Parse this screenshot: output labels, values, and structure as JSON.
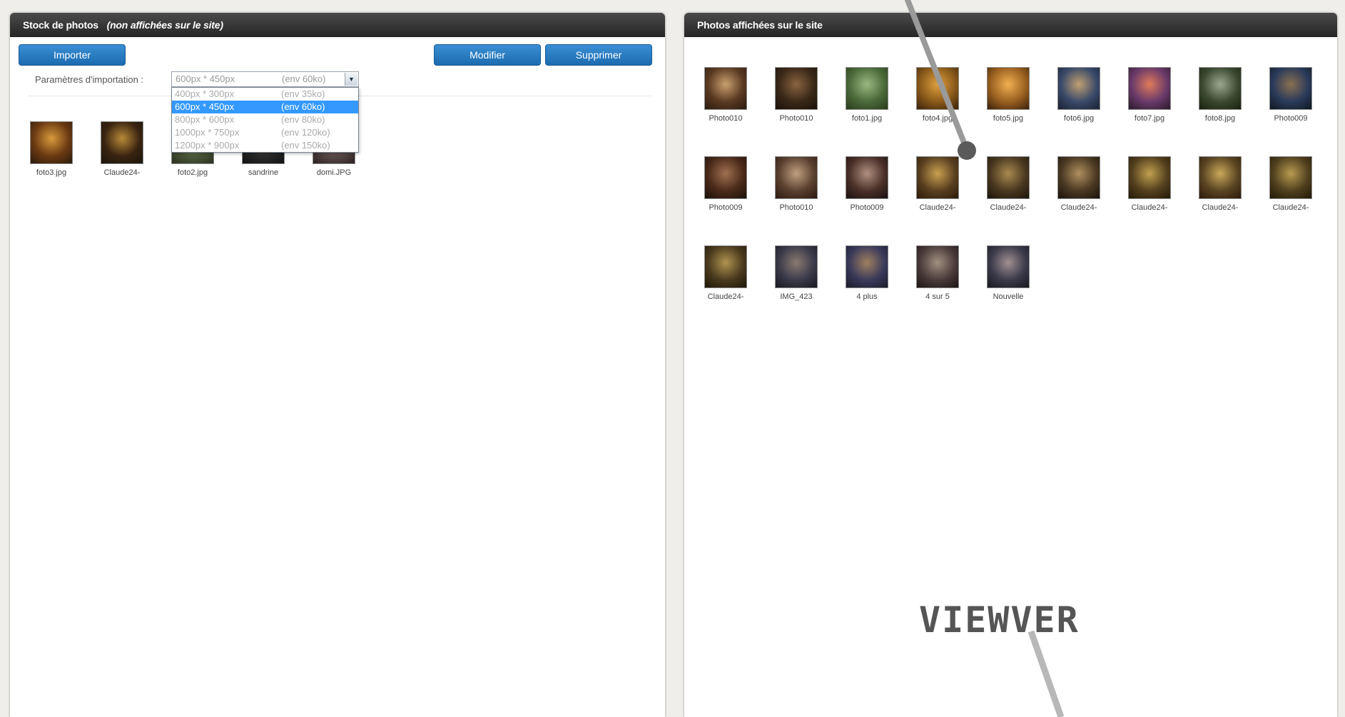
{
  "left_panel": {
    "title": "Stock de photos",
    "note": "(non affichées sur le site)",
    "buttons": {
      "import": "Importer",
      "modify": "Modifier",
      "delete": "Supprimer"
    },
    "import_params": {
      "label": "Paramètres d'importation :",
      "selected_size": "600px * 450px",
      "selected_weight": "(env 60ko)",
      "options": [
        {
          "size": "400px * 300px",
          "weight": "(env 35ko)"
        },
        {
          "size": "600px * 450px",
          "weight": "(env 60ko)"
        },
        {
          "size": "800px * 600px",
          "weight": "(env 80ko)"
        },
        {
          "size": "1000px * 750px",
          "weight": "(env 120ko)"
        },
        {
          "size": "1200px * 900px",
          "weight": "(env 150ko)"
        }
      ],
      "selected_index": 1
    },
    "photos": [
      {
        "caption": "foto3.jpg",
        "colors": [
          "#6b3a12",
          "#d89a3c",
          "#2b1a0c"
        ]
      },
      {
        "caption": "Claude24-",
        "colors": [
          "#3a2410",
          "#b88a3a",
          "#1b140c"
        ]
      },
      {
        "caption": "foto2.jpg",
        "colors": [
          "#4c5a3a",
          "#9fae80",
          "#2a3020"
        ]
      },
      {
        "caption": "sandrine",
        "colors": [
          "#2a2a2a",
          "#6a5040",
          "#111111"
        ]
      },
      {
        "caption": "domi.JPG",
        "colors": [
          "#5a4a4a",
          "#a08070",
          "#2a2020"
        ]
      }
    ]
  },
  "right_panel": {
    "title": "Photos affichées sur le site",
    "photos": [
      {
        "caption": "Photo010",
        "colors": [
          "#5a3a22",
          "#c9a070",
          "#2a1a10"
        ]
      },
      {
        "caption": "Photo010",
        "colors": [
          "#3a2818",
          "#8a6440",
          "#1a120a"
        ]
      },
      {
        "caption": "foto1.jpg",
        "colors": [
          "#4a6a3a",
          "#9ab880",
          "#2a3a1a"
        ]
      },
      {
        "caption": "foto4.jpg",
        "colors": [
          "#8a5a1a",
          "#e0a040",
          "#3a200a"
        ]
      },
      {
        "caption": "foto5.jpg",
        "colors": [
          "#9a6020",
          "#f0b050",
          "#3a200a"
        ]
      },
      {
        "caption": "foto6.jpg",
        "colors": [
          "#3a4a6a",
          "#c0a070",
          "#1a2030"
        ]
      },
      {
        "caption": "foto7.jpg",
        "colors": [
          "#6a3a6a",
          "#e07a5a",
          "#2a1a2a"
        ]
      },
      {
        "caption": "foto8.jpg",
        "colors": [
          "#3a4a30",
          "#9aa890",
          "#1a2010"
        ]
      },
      {
        "caption": "Photo009",
        "colors": [
          "#2a3a5a",
          "#8a7050",
          "#101820"
        ]
      },
      {
        "caption": "Photo009",
        "colors": [
          "#4a2a1a",
          "#a07050",
          "#1a100a"
        ]
      },
      {
        "caption": "Photo010",
        "colors": [
          "#5a4030",
          "#c0a080",
          "#2a1a10"
        ]
      },
      {
        "caption": "Photo009",
        "colors": [
          "#4a3028",
          "#b09080",
          "#1a1010"
        ]
      },
      {
        "caption": "Claude24-",
        "colors": [
          "#5a4020",
          "#c8a050",
          "#2a1a0a"
        ]
      },
      {
        "caption": "Claude24-",
        "colors": [
          "#4a3820",
          "#a88a50",
          "#1a140a"
        ]
      },
      {
        "caption": "Claude24-",
        "colors": [
          "#4a3822",
          "#b09060",
          "#1a140c"
        ]
      },
      {
        "caption": "Claude24-",
        "colors": [
          "#54401e",
          "#c0a050",
          "#241808"
        ]
      },
      {
        "caption": "Claude24-",
        "colors": [
          "#5a4422",
          "#c8a85a",
          "#2a1a0a"
        ]
      },
      {
        "caption": "Claude24-",
        "colors": [
          "#50401e",
          "#b89a50",
          "#201808"
        ]
      },
      {
        "caption": "Claude24-",
        "colors": [
          "#4a3a1e",
          "#b09450",
          "#1e1608"
        ]
      },
      {
        "caption": "IMG_423",
        "colors": [
          "#3a3a4a",
          "#8a7a70",
          "#181820"
        ]
      },
      {
        "caption": "4 plus",
        "colors": [
          "#3a3a5a",
          "#a08060",
          "#1a1a2a"
        ]
      },
      {
        "caption": "4 sur 5",
        "colors": [
          "#4a3a3a",
          "#a09080",
          "#1a1414"
        ]
      },
      {
        "caption": "Nouvelle",
        "colors": [
          "#3a3a4a",
          "#a09090",
          "#181820"
        ]
      }
    ]
  },
  "overlay": {
    "viewer_text": "VIEWVER"
  },
  "theme": {
    "accent": "#1c6bb0",
    "header_bg": "#2d2d2d",
    "selection": "#3399ff",
    "pointer_color": "#555555"
  }
}
